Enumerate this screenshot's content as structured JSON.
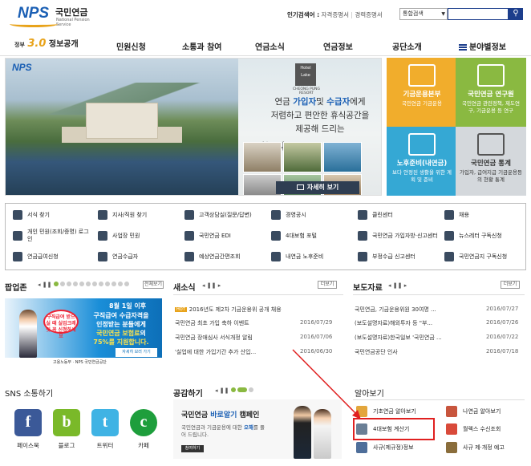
{
  "header": {
    "logo_text": "NPS",
    "logo_korean": "국민연금",
    "logo_english": "National Pension Service",
    "popular_label": "인기검색어 :",
    "popular_items": [
      "자격증명서",
      "경력증명서"
    ],
    "search_select": "통합검색",
    "search_placeholder": ""
  },
  "gnb": {
    "first_prefix": "정부",
    "first_number": "3.0",
    "first_label": "정보공개",
    "items": [
      "민원신청",
      "소통과 참여",
      "연금소식",
      "연금정보",
      "공단소개"
    ],
    "menu_label": "분야별정보"
  },
  "banner": {
    "logo": "NPS",
    "brand": "Hotel Lake",
    "brand_sub": "CHEONG PUNG RESORT",
    "line1_a": "연금 ",
    "line1_b": "가입자",
    "line1_c": "및 ",
    "line1_d": "수급자",
    "line1_e": "에게",
    "line2": "저렴하고 편안한 휴식공간을",
    "line3_a": "제공해 드리는 ",
    "line3_b": "\"청풍리조트\"",
    "more_label": "자세히 보기"
  },
  "tiles": [
    {
      "title": "기금운용본부",
      "desc": "국민연금 기금운용",
      "color": "#f1ad2c"
    },
    {
      "title": "국민연금 연구원",
      "desc": "국민연금 관련정책, 제도연구, 기금운용 등 연구",
      "color": "#8ab941"
    },
    {
      "title": "노후준비(내연금)",
      "desc": "보다 안정된 생활을 위한 계획 및 준비",
      "color": "#35a8d4"
    },
    {
      "title": "국민연금 통계",
      "desc": "가입자, 급여지급 기금운용등의 현황 통계",
      "color": "#d4d8dc"
    }
  ],
  "quick_links": [
    "서식 찾기",
    "지사/직원 찾기",
    "고객상담실(질문/답변)",
    "경영공시",
    "클린센터",
    "채용",
    "개인 민원(조회/증명) 로그인",
    "사업장 민원",
    "국민연금 EDI",
    "4대보험 포털",
    "국민연금 가입자방·신고센터",
    "뉴스레터 구독신청",
    "연금급여신청",
    "연금수급자",
    "예상연금간편조회",
    "내연금 노후준비",
    "부정수급 신고센터",
    "국민연금지 구독신청"
  ],
  "popupzone": {
    "title": "팝업존",
    "all_label": "전체보기",
    "line1": "8월 1일 이후",
    "line2a": "구직급여 수급자격을",
    "line2b": "인정받는 분들에게",
    "line3a": "국민연금 보험료",
    "line3b": "의",
    "line4": "75%를 지원합니다.",
    "badge": "구직급여 받으실 때 실업크레딧 꼭 신청하세요",
    "button": "자세히 보러 가기",
    "footer": "고용노동부 · NPS 국민연금공단"
  },
  "news": {
    "title": "새소식",
    "more": "더보기",
    "items": [
      {
        "hot": "HOT",
        "text": "2016년도 제2차 기금운용위 공개 채용",
        "date": ""
      },
      {
        "text": "국민연금 최초 가입 축하 이벤트",
        "date": "2016/07/29"
      },
      {
        "text": "국민연금 장애심사 서식개정 알림",
        "date": "2016/07/06"
      },
      {
        "text": "'실업에 대한 가입기간 추가 산입...",
        "date": "2016/06/30"
      }
    ]
  },
  "press": {
    "title": "보도자료",
    "more": "더보기",
    "items": [
      {
        "text": "국민연금, 기금운용위원 30여명 ...",
        "date": "2016/07/27"
      },
      {
        "text": "(보도설명자료)해외투자 등 \"부...",
        "date": "2016/07/26"
      },
      {
        "text": "(보도설명자료)한국일보 '국민연금 ...",
        "date": "2016/07/22"
      },
      {
        "text": "국민연금공단 인사",
        "date": "2016/07/18"
      }
    ]
  },
  "sns": {
    "title": "SNS 소통하기",
    "items": [
      {
        "icon": "f",
        "label": "페이스북",
        "color": "#3b5998"
      },
      {
        "icon": "b",
        "label": "블로그",
        "color": "#7ab929"
      },
      {
        "icon": "t",
        "label": "트위터",
        "color": "#3fb3e4"
      },
      {
        "icon": "c",
        "label": "카페",
        "color": "#1e9e3c"
      }
    ]
  },
  "gonggam": {
    "title": "공감하기",
    "campaign_a": "국민연금 ",
    "campaign_b": "바로알기",
    "campaign_c": " 캠페인",
    "desc_a": "국민연금과 기금운용에 대한 ",
    "desc_b": "오해",
    "desc_c": "를 풀어 드립니다.",
    "button": "참여하기"
  },
  "learn": {
    "title": "알아보기",
    "items": [
      "기초연금 알아보기",
      "나연금 알아보기",
      "4대보험 계산기",
      "월렉스 수신조회",
      "사규(제규정)정보",
      "사규 제·개정 예고"
    ]
  }
}
